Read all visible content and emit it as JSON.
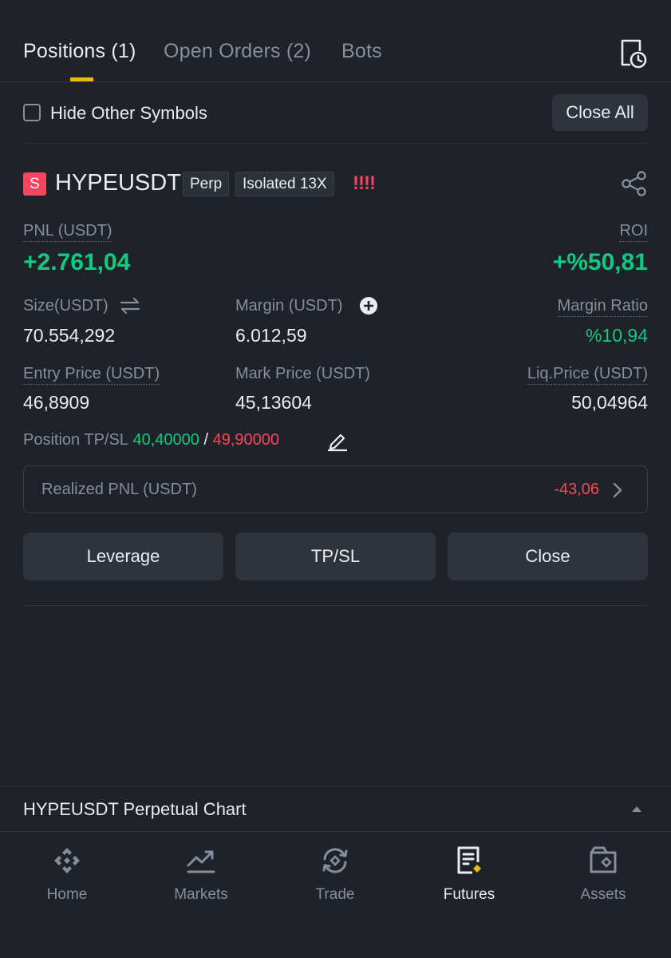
{
  "tabs": [
    {
      "label": "Positions (1)"
    },
    {
      "label": "Open Orders (2)"
    },
    {
      "label": "Bots"
    }
  ],
  "hide_other_symbols": {
    "label": "Hide Other Symbols",
    "checked": false
  },
  "close_all_label": "Close All",
  "position": {
    "side": "S",
    "symbol": "HYPEUSDT",
    "type_tag": "Perp",
    "margin_tag": "Isolated 13X",
    "warning": "!!!!",
    "pnl_label": "PNL (USDT)",
    "pnl_value": "+2.761,04",
    "roi_label": "ROI",
    "roi_value": "+%50,81",
    "size_label": "Size(USDT)",
    "size_value": "70.554,292",
    "margin_label": "Margin (USDT)",
    "margin_value": "6.012,59",
    "margin_ratio_label": "Margin Ratio",
    "margin_ratio_value": "%10,94",
    "entry_label": "Entry Price (USDT)",
    "entry_value": "46,8909",
    "mark_label": "Mark Price (USDT)",
    "mark_value": "45,13604",
    "liq_label": "Liq.Price (USDT)",
    "liq_value": "50,04964",
    "tpsl_label": "Position TP/SL",
    "tp_value": "40,40000",
    "tpsl_sep": "/",
    "sl_value": "49,90000",
    "realized_label": "Realized PNL (USDT)",
    "realized_value": "-43,06"
  },
  "actions": {
    "leverage": "Leverage",
    "tpsl": "TP/SL",
    "close": "Close"
  },
  "chart_bar": {
    "title": "HYPEUSDT Perpetual Chart"
  },
  "nav": [
    {
      "label": "Home",
      "icon": "home-icon"
    },
    {
      "label": "Markets",
      "icon": "markets-icon"
    },
    {
      "label": "Trade",
      "icon": "trade-icon"
    },
    {
      "label": "Futures",
      "icon": "futures-icon",
      "active": true
    },
    {
      "label": "Assets",
      "icon": "assets-icon"
    }
  ],
  "colors": {
    "accent": "#f0b90b",
    "positive": "#0ecb81",
    "negative": "#f6465d",
    "background": "#1f2229"
  }
}
